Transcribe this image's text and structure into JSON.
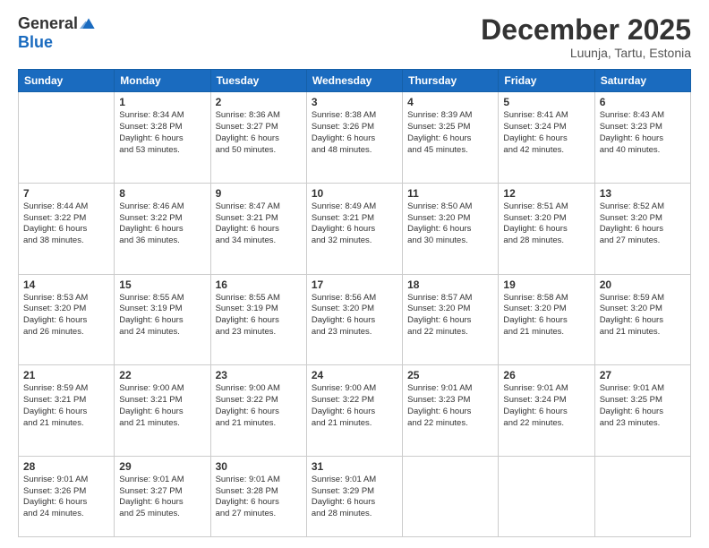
{
  "logo": {
    "general": "General",
    "blue": "Blue"
  },
  "header": {
    "month": "December 2025",
    "location": "Luunja, Tartu, Estonia"
  },
  "weekdays": [
    "Sunday",
    "Monday",
    "Tuesday",
    "Wednesday",
    "Thursday",
    "Friday",
    "Saturday"
  ],
  "weeks": [
    [
      {
        "day": "",
        "sunrise": "",
        "sunset": "",
        "daylight": ""
      },
      {
        "day": "1",
        "sunrise": "Sunrise: 8:34 AM",
        "sunset": "Sunset: 3:28 PM",
        "daylight": "Daylight: 6 hours and 53 minutes."
      },
      {
        "day": "2",
        "sunrise": "Sunrise: 8:36 AM",
        "sunset": "Sunset: 3:27 PM",
        "daylight": "Daylight: 6 hours and 50 minutes."
      },
      {
        "day": "3",
        "sunrise": "Sunrise: 8:38 AM",
        "sunset": "Sunset: 3:26 PM",
        "daylight": "Daylight: 6 hours and 48 minutes."
      },
      {
        "day": "4",
        "sunrise": "Sunrise: 8:39 AM",
        "sunset": "Sunset: 3:25 PM",
        "daylight": "Daylight: 6 hours and 45 minutes."
      },
      {
        "day": "5",
        "sunrise": "Sunrise: 8:41 AM",
        "sunset": "Sunset: 3:24 PM",
        "daylight": "Daylight: 6 hours and 42 minutes."
      },
      {
        "day": "6",
        "sunrise": "Sunrise: 8:43 AM",
        "sunset": "Sunset: 3:23 PM",
        "daylight": "Daylight: 6 hours and 40 minutes."
      }
    ],
    [
      {
        "day": "7",
        "sunrise": "Sunrise: 8:44 AM",
        "sunset": "Sunset: 3:22 PM",
        "daylight": "Daylight: 6 hours and 38 minutes."
      },
      {
        "day": "8",
        "sunrise": "Sunrise: 8:46 AM",
        "sunset": "Sunset: 3:22 PM",
        "daylight": "Daylight: 6 hours and 36 minutes."
      },
      {
        "day": "9",
        "sunrise": "Sunrise: 8:47 AM",
        "sunset": "Sunset: 3:21 PM",
        "daylight": "Daylight: 6 hours and 34 minutes."
      },
      {
        "day": "10",
        "sunrise": "Sunrise: 8:49 AM",
        "sunset": "Sunset: 3:21 PM",
        "daylight": "Daylight: 6 hours and 32 minutes."
      },
      {
        "day": "11",
        "sunrise": "Sunrise: 8:50 AM",
        "sunset": "Sunset: 3:20 PM",
        "daylight": "Daylight: 6 hours and 30 minutes."
      },
      {
        "day": "12",
        "sunrise": "Sunrise: 8:51 AM",
        "sunset": "Sunset: 3:20 PM",
        "daylight": "Daylight: 6 hours and 28 minutes."
      },
      {
        "day": "13",
        "sunrise": "Sunrise: 8:52 AM",
        "sunset": "Sunset: 3:20 PM",
        "daylight": "Daylight: 6 hours and 27 minutes."
      }
    ],
    [
      {
        "day": "14",
        "sunrise": "Sunrise: 8:53 AM",
        "sunset": "Sunset: 3:20 PM",
        "daylight": "Daylight: 6 hours and 26 minutes."
      },
      {
        "day": "15",
        "sunrise": "Sunrise: 8:55 AM",
        "sunset": "Sunset: 3:19 PM",
        "daylight": "Daylight: 6 hours and 24 minutes."
      },
      {
        "day": "16",
        "sunrise": "Sunrise: 8:55 AM",
        "sunset": "Sunset: 3:19 PM",
        "daylight": "Daylight: 6 hours and 23 minutes."
      },
      {
        "day": "17",
        "sunrise": "Sunrise: 8:56 AM",
        "sunset": "Sunset: 3:20 PM",
        "daylight": "Daylight: 6 hours and 23 minutes."
      },
      {
        "day": "18",
        "sunrise": "Sunrise: 8:57 AM",
        "sunset": "Sunset: 3:20 PM",
        "daylight": "Daylight: 6 hours and 22 minutes."
      },
      {
        "day": "19",
        "sunrise": "Sunrise: 8:58 AM",
        "sunset": "Sunset: 3:20 PM",
        "daylight": "Daylight: 6 hours and 21 minutes."
      },
      {
        "day": "20",
        "sunrise": "Sunrise: 8:59 AM",
        "sunset": "Sunset: 3:20 PM",
        "daylight": "Daylight: 6 hours and 21 minutes."
      }
    ],
    [
      {
        "day": "21",
        "sunrise": "Sunrise: 8:59 AM",
        "sunset": "Sunset: 3:21 PM",
        "daylight": "Daylight: 6 hours and 21 minutes."
      },
      {
        "day": "22",
        "sunrise": "Sunrise: 9:00 AM",
        "sunset": "Sunset: 3:21 PM",
        "daylight": "Daylight: 6 hours and 21 minutes."
      },
      {
        "day": "23",
        "sunrise": "Sunrise: 9:00 AM",
        "sunset": "Sunset: 3:22 PM",
        "daylight": "Daylight: 6 hours and 21 minutes."
      },
      {
        "day": "24",
        "sunrise": "Sunrise: 9:00 AM",
        "sunset": "Sunset: 3:22 PM",
        "daylight": "Daylight: 6 hours and 21 minutes."
      },
      {
        "day": "25",
        "sunrise": "Sunrise: 9:01 AM",
        "sunset": "Sunset: 3:23 PM",
        "daylight": "Daylight: 6 hours and 22 minutes."
      },
      {
        "day": "26",
        "sunrise": "Sunrise: 9:01 AM",
        "sunset": "Sunset: 3:24 PM",
        "daylight": "Daylight: 6 hours and 22 minutes."
      },
      {
        "day": "27",
        "sunrise": "Sunrise: 9:01 AM",
        "sunset": "Sunset: 3:25 PM",
        "daylight": "Daylight: 6 hours and 23 minutes."
      }
    ],
    [
      {
        "day": "28",
        "sunrise": "Sunrise: 9:01 AM",
        "sunset": "Sunset: 3:26 PM",
        "daylight": "Daylight: 6 hours and 24 minutes."
      },
      {
        "day": "29",
        "sunrise": "Sunrise: 9:01 AM",
        "sunset": "Sunset: 3:27 PM",
        "daylight": "Daylight: 6 hours and 25 minutes."
      },
      {
        "day": "30",
        "sunrise": "Sunrise: 9:01 AM",
        "sunset": "Sunset: 3:28 PM",
        "daylight": "Daylight: 6 hours and 27 minutes."
      },
      {
        "day": "31",
        "sunrise": "Sunrise: 9:01 AM",
        "sunset": "Sunset: 3:29 PM",
        "daylight": "Daylight: 6 hours and 28 minutes."
      },
      {
        "day": "",
        "sunrise": "",
        "sunset": "",
        "daylight": ""
      },
      {
        "day": "",
        "sunrise": "",
        "sunset": "",
        "daylight": ""
      },
      {
        "day": "",
        "sunrise": "",
        "sunset": "",
        "daylight": ""
      }
    ]
  ]
}
